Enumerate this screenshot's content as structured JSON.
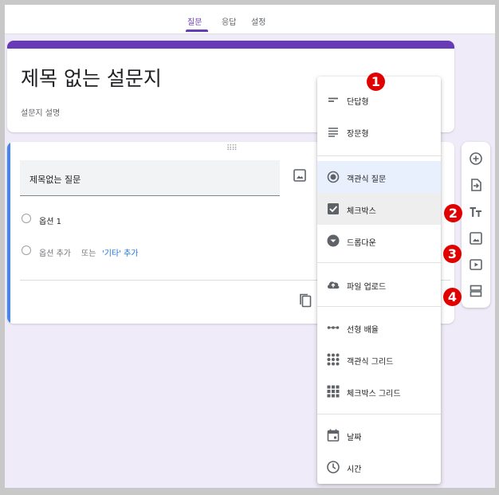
{
  "tabs": [
    {
      "label": "질문",
      "active": true
    },
    {
      "label": "응답",
      "active": false
    },
    {
      "label": "설정",
      "active": false
    }
  ],
  "form": {
    "title": "제목 없는 설문지",
    "description": "설문지 설명"
  },
  "question": {
    "text": "제목없는 질문",
    "option_1": "옵션 1",
    "add_option": "옵션 추가",
    "or_text": "또는",
    "add_other": "'기타' 추가"
  },
  "menu": {
    "items": [
      {
        "label": "단답형",
        "icon": "short-answer-icon"
      },
      {
        "label": "장문형",
        "icon": "paragraph-icon"
      },
      {
        "label": "객관식 질문",
        "icon": "radio-button-icon"
      },
      {
        "label": "체크박스",
        "icon": "checkbox-icon"
      },
      {
        "label": "드롭다운",
        "icon": "dropdown-icon"
      },
      {
        "label": "파일 업로드",
        "icon": "cloud-upload-icon"
      },
      {
        "label": "선형 배율",
        "icon": "linear-scale-icon"
      },
      {
        "label": "객관식 그리드",
        "icon": "radio-grid-icon"
      },
      {
        "label": "체크박스 그리드",
        "icon": "checkbox-grid-icon"
      },
      {
        "label": "날짜",
        "icon": "calendar-icon"
      },
      {
        "label": "시간",
        "icon": "clock-icon"
      }
    ]
  },
  "toolbar": {
    "tools": [
      "add-question-icon",
      "import-questions-icon",
      "add-title-icon",
      "add-image-icon",
      "add-video-icon",
      "add-section-icon"
    ]
  },
  "annotations": [
    "1",
    "2",
    "3",
    "4"
  ],
  "colors": {
    "accent": "#673ab7",
    "question_accent": "#4285f4",
    "link": "#1a73e8",
    "badge": "#e00000",
    "background": "#f0ebf8"
  }
}
